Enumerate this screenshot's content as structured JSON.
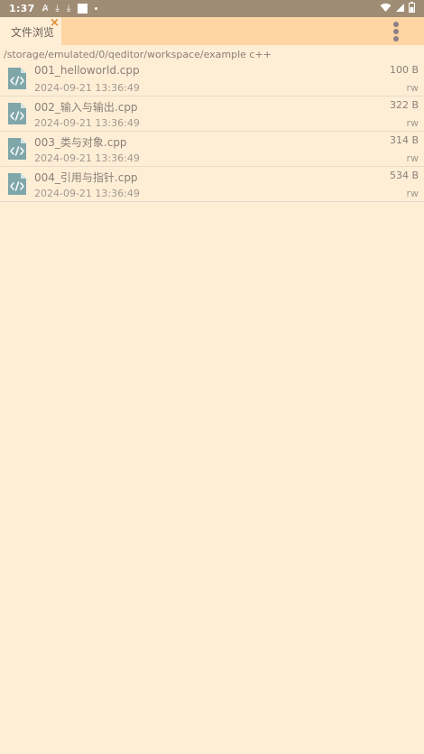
{
  "status_bar": {
    "time": "1:37",
    "icons_left": [
      "font-a-icon",
      "download-icon",
      "download-icon",
      "square-icon",
      "dot-icon"
    ],
    "icons_right": [
      "wifi-icon",
      "signal-icon",
      "battery-icon"
    ]
  },
  "tab": {
    "label": "文件浏览",
    "close_glyph": "×"
  },
  "path": "/storage/emulated/0/qeditor/workspace/example c++",
  "files": [
    {
      "name": "001_helloworld.cpp",
      "size": "100 B",
      "date": "2024-09-21 13:36:49",
      "perm": "rw"
    },
    {
      "name": "002_输入与输出.cpp",
      "size": "322 B",
      "date": "2024-09-21 13:36:49",
      "perm": "rw"
    },
    {
      "name": "003_类与对象.cpp",
      "size": "314 B",
      "date": "2024-09-21 13:36:49",
      "perm": "rw"
    },
    {
      "name": "004_引用与指针.cpp",
      "size": "534 B",
      "date": "2024-09-21 13:36:49",
      "perm": "rw"
    }
  ],
  "colors": {
    "background": "#feeed6",
    "tab_bar": "#fed5a3",
    "status_bar": "#a08c74",
    "close_accent": "#e08a2e",
    "file_icon": "#7fa6a9"
  }
}
